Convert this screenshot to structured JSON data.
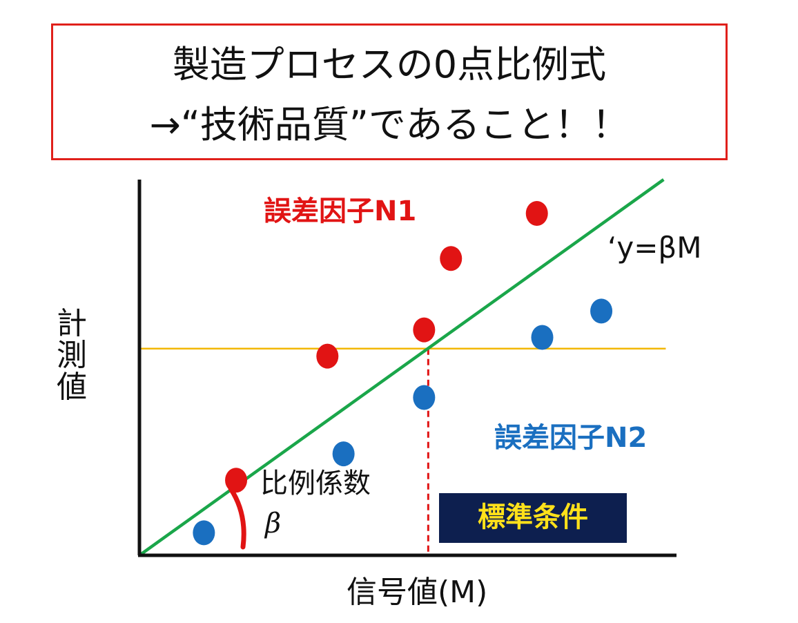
{
  "title": {
    "line1": "製造プロセスの0点比例式",
    "line2": "→“技術品質”であること！！"
  },
  "labels": {
    "noise_n1": "誤差因子N1",
    "noise_n2": "誤差因子N2",
    "equation": "‘y=βM",
    "y_axis": "計測値",
    "x_axis": "信号値(M)",
    "coefficient": "比例係数",
    "beta": "β",
    "standard_condition": "標準条件"
  },
  "colors": {
    "title_border": "#e0201b",
    "axis": "#111111",
    "regression_line": "#1aa64a",
    "reference_line": "#f2b705",
    "dashed_marker": "#e11414",
    "n1_points": "#e11414",
    "n2_points": "#1a6fc0",
    "angle_arc": "#e11414",
    "std_box_bg": "#0d1f4f",
    "std_box_text": "#ffe11a"
  },
  "points": {
    "n1": [
      {
        "x": 0.18,
        "y": 0.2
      },
      {
        "x": 0.35,
        "y": 0.53
      },
      {
        "x": 0.53,
        "y": 0.6
      },
      {
        "x": 0.58,
        "y": 0.79
      },
      {
        "x": 0.74,
        "y": 0.91
      }
    ],
    "n2": [
      {
        "x": 0.12,
        "y": 0.06
      },
      {
        "x": 0.38,
        "y": 0.27
      },
      {
        "x": 0.53,
        "y": 0.42
      },
      {
        "x": 0.75,
        "y": 0.58
      },
      {
        "x": 0.86,
        "y": 0.65
      }
    ]
  },
  "axes": {
    "x_max": 1.0,
    "y_max": 1.0,
    "reference_level_y": 0.55,
    "standard_signal_x": 0.53,
    "line_slope": 1.04
  }
}
